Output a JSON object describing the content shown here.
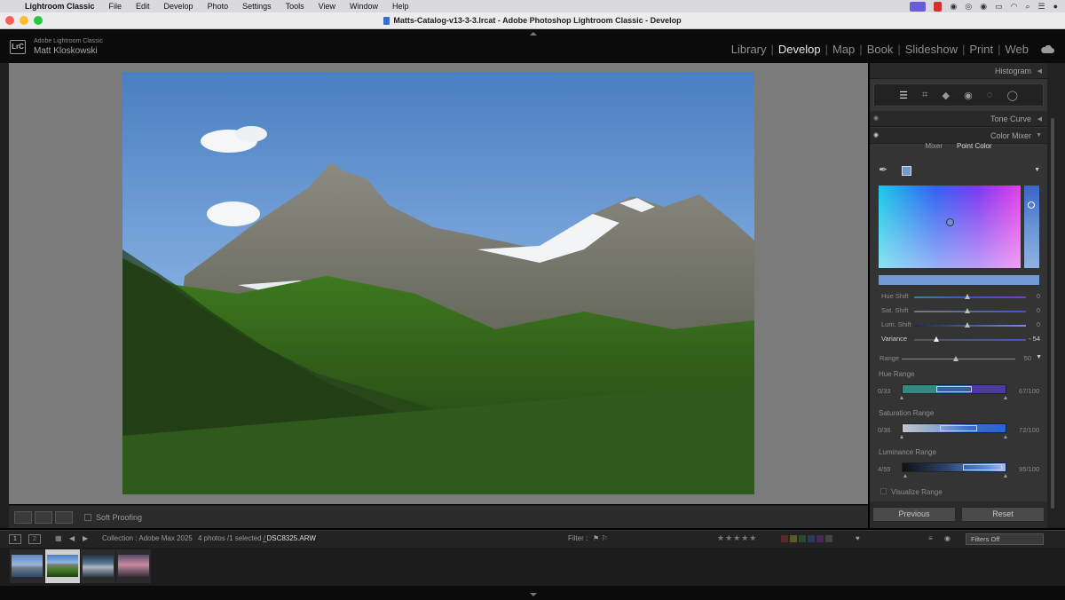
{
  "menubar": {
    "app_name": "Lightroom Classic",
    "items": [
      "File",
      "Edit",
      "Develop",
      "Photo",
      "Settings",
      "Tools",
      "View",
      "Window",
      "Help"
    ]
  },
  "window": {
    "title": "Matts-Catalog-v13-3-3.lrcat - Adobe Photoshop Lightroom Classic - Develop"
  },
  "identity": {
    "product": "Adobe Lightroom Classic",
    "user": "Matt Kloskowski",
    "badge": "LrC"
  },
  "modules": {
    "library": "Library",
    "develop": "Develop",
    "map": "Map",
    "book": "Book",
    "slideshow": "Slideshow",
    "print": "Print",
    "web": "Web",
    "active": "Develop"
  },
  "panel": {
    "histogram": "Histogram",
    "tone_curve": "Tone Curve",
    "color_mixer": "Color Mixer",
    "tabs": {
      "mixer": "Mixer",
      "point_color": "Point Color",
      "active": "Point Color"
    },
    "sliders": {
      "hue_shift": {
        "label": "Hue Shift",
        "value": "0"
      },
      "sat_shift": {
        "label": "Sat. Shift",
        "value": "0"
      },
      "lum_shift": {
        "label": "Lum. Shift",
        "value": "0"
      },
      "variance": {
        "label": "Variance",
        "value": "- 54"
      },
      "range": {
        "label": "Range",
        "value": "50"
      }
    },
    "hue_range": {
      "title": "Hue Range",
      "lo": "0/33",
      "hi": "67/100"
    },
    "saturation_range": {
      "title": "Saturation Range",
      "lo": "0/36",
      "hi": "72/100"
    },
    "luminance_range": {
      "title": "Luminance Range",
      "lo": "4/59",
      "hi": "95/100"
    },
    "visualize_range": "Visualize Range",
    "previous": "Previous",
    "reset": "Reset",
    "selected_swatch": "#6f9ad4"
  },
  "toolbar": {
    "soft_proofing": "Soft Proofing"
  },
  "filmstrip_bar": {
    "screen1": "1",
    "screen2": "2",
    "collection": "Collection : Adobe Max 2025",
    "count": "4 photos /1 selected /",
    "filename": "_DSC8325.ARW",
    "filter_label": "Filter :",
    "filters_off": "Filters Off"
  },
  "filmstrip": {
    "count": 4,
    "selected_index": 1
  }
}
